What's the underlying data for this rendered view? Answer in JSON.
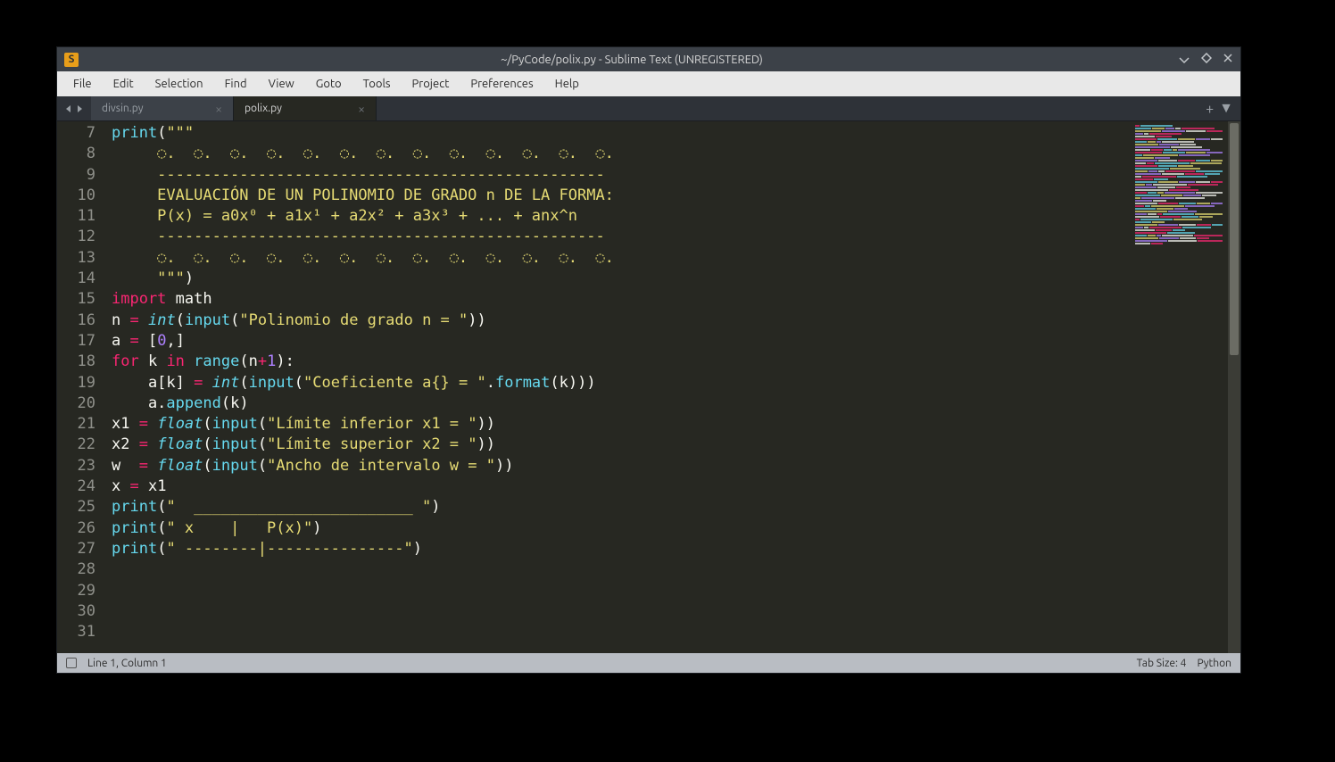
{
  "window": {
    "title": "~/PyCode/polix.py - Sublime Text (UNREGISTERED)",
    "app_icon_letter": "S"
  },
  "menubar": {
    "items": [
      "File",
      "Edit",
      "Selection",
      "Find",
      "View",
      "Goto",
      "Tools",
      "Project",
      "Preferences",
      "Help"
    ]
  },
  "tabs": {
    "items": [
      {
        "label": "divsin.py",
        "active": false
      },
      {
        "label": "polix.py",
        "active": true
      }
    ]
  },
  "editor": {
    "first_line_number": 7,
    "lines": [
      {
        "n": 7,
        "segments": [
          {
            "t": "print",
            "c": "k-call"
          },
          {
            "t": "(",
            "c": "k-punc"
          },
          {
            "t": "\"\"\"",
            "c": "k-str"
          }
        ]
      },
      {
        "n": 8,
        "segments": [
          {
            "t": "     ◌.  ◌.  ◌.  ◌.  ◌.  ◌.  ◌.  ◌.  ◌.  ◌.  ◌.  ◌.  ◌.",
            "c": "k-str"
          }
        ]
      },
      {
        "n": 9,
        "segments": [
          {
            "t": "     -------------------------------------------------",
            "c": "k-str"
          }
        ]
      },
      {
        "n": 10,
        "segments": [
          {
            "t": "     EVALUACIÓN DE UN POLINOMIO DE GRADO n DE LA FORMA:",
            "c": "k-str"
          }
        ]
      },
      {
        "n": 11,
        "segments": [
          {
            "t": "     P(x) = a0x⁰ + a1x¹ + a2x² + a3x³ + ... + anx^n",
            "c": "k-str"
          }
        ]
      },
      {
        "n": 12,
        "segments": [
          {
            "t": "     -------------------------------------------------",
            "c": "k-str"
          }
        ]
      },
      {
        "n": 13,
        "segments": [
          {
            "t": "     ◌.  ◌.  ◌.  ◌.  ◌.  ◌.  ◌.  ◌.  ◌.  ◌.  ◌.  ◌.  ◌.",
            "c": "k-str"
          }
        ]
      },
      {
        "n": 14,
        "segments": [
          {
            "t": "     \"\"\"",
            "c": "k-str"
          },
          {
            "t": ")",
            "c": "k-punc"
          }
        ]
      },
      {
        "n": 15,
        "segments": [
          {
            "t": "import",
            "c": "k-keyword"
          },
          {
            "t": " math",
            "c": "k-punc"
          }
        ]
      },
      {
        "n": 16,
        "segments": [
          {
            "t": "",
            "c": "k-punc"
          }
        ]
      },
      {
        "n": 17,
        "segments": [
          {
            "t": "n ",
            "c": "k-punc"
          },
          {
            "t": "=",
            "c": "k-keyword"
          },
          {
            "t": " ",
            "c": "k-punc"
          },
          {
            "t": "int",
            "c": "k-func"
          },
          {
            "t": "(",
            "c": "k-punc"
          },
          {
            "t": "input",
            "c": "k-call"
          },
          {
            "t": "(",
            "c": "k-punc"
          },
          {
            "t": "\"Polinomio de grado n = \"",
            "c": "k-str"
          },
          {
            "t": "))",
            "c": "k-punc"
          }
        ]
      },
      {
        "n": 18,
        "segments": [
          {
            "t": "",
            "c": "k-punc"
          }
        ]
      },
      {
        "n": 19,
        "segments": [
          {
            "t": "a ",
            "c": "k-punc"
          },
          {
            "t": "=",
            "c": "k-keyword"
          },
          {
            "t": " [",
            "c": "k-punc"
          },
          {
            "t": "0",
            "c": "k-num"
          },
          {
            "t": ",]",
            "c": "k-punc"
          }
        ]
      },
      {
        "n": 20,
        "segments": [
          {
            "t": "for",
            "c": "k-keyword"
          },
          {
            "t": " k ",
            "c": "k-punc"
          },
          {
            "t": "in",
            "c": "k-keyword"
          },
          {
            "t": " ",
            "c": "k-punc"
          },
          {
            "t": "range",
            "c": "k-call"
          },
          {
            "t": "(n",
            "c": "k-punc"
          },
          {
            "t": "+",
            "c": "k-keyword"
          },
          {
            "t": "1",
            "c": "k-num"
          },
          {
            "t": "):",
            "c": "k-punc"
          }
        ]
      },
      {
        "n": 21,
        "segments": [
          {
            "t": "    a[k] ",
            "c": "k-punc"
          },
          {
            "t": "=",
            "c": "k-keyword"
          },
          {
            "t": " ",
            "c": "k-punc"
          },
          {
            "t": "int",
            "c": "k-func"
          },
          {
            "t": "(",
            "c": "k-punc"
          },
          {
            "t": "input",
            "c": "k-call"
          },
          {
            "t": "(",
            "c": "k-punc"
          },
          {
            "t": "\"Coeficiente a{} = \"",
            "c": "k-str"
          },
          {
            "t": ".",
            "c": "k-punc"
          },
          {
            "t": "format",
            "c": "k-call"
          },
          {
            "t": "(k)))",
            "c": "k-punc"
          }
        ]
      },
      {
        "n": 22,
        "segments": [
          {
            "t": "    a.",
            "c": "k-punc"
          },
          {
            "t": "append",
            "c": "k-call"
          },
          {
            "t": "(k)",
            "c": "k-punc"
          }
        ]
      },
      {
        "n": 23,
        "segments": [
          {
            "t": "",
            "c": "k-punc"
          }
        ]
      },
      {
        "n": 24,
        "segments": [
          {
            "t": "x1 ",
            "c": "k-punc"
          },
          {
            "t": "=",
            "c": "k-keyword"
          },
          {
            "t": " ",
            "c": "k-punc"
          },
          {
            "t": "float",
            "c": "k-func"
          },
          {
            "t": "(",
            "c": "k-punc"
          },
          {
            "t": "input",
            "c": "k-call"
          },
          {
            "t": "(",
            "c": "k-punc"
          },
          {
            "t": "\"Límite inferior x1 = \"",
            "c": "k-str"
          },
          {
            "t": "))",
            "c": "k-punc"
          }
        ]
      },
      {
        "n": 25,
        "segments": [
          {
            "t": "x2 ",
            "c": "k-punc"
          },
          {
            "t": "=",
            "c": "k-keyword"
          },
          {
            "t": " ",
            "c": "k-punc"
          },
          {
            "t": "float",
            "c": "k-func"
          },
          {
            "t": "(",
            "c": "k-punc"
          },
          {
            "t": "input",
            "c": "k-call"
          },
          {
            "t": "(",
            "c": "k-punc"
          },
          {
            "t": "\"Límite superior x2 = \"",
            "c": "k-str"
          },
          {
            "t": "))",
            "c": "k-punc"
          }
        ]
      },
      {
        "n": 26,
        "segments": [
          {
            "t": "w  ",
            "c": "k-punc"
          },
          {
            "t": "=",
            "c": "k-keyword"
          },
          {
            "t": " ",
            "c": "k-punc"
          },
          {
            "t": "float",
            "c": "k-func"
          },
          {
            "t": "(",
            "c": "k-punc"
          },
          {
            "t": "input",
            "c": "k-call"
          },
          {
            "t": "(",
            "c": "k-punc"
          },
          {
            "t": "\"Ancho de intervalo w = \"",
            "c": "k-str"
          },
          {
            "t": "))",
            "c": "k-punc"
          }
        ]
      },
      {
        "n": 27,
        "segments": [
          {
            "t": "",
            "c": "k-punc"
          }
        ]
      },
      {
        "n": 28,
        "segments": [
          {
            "t": "x ",
            "c": "k-punc"
          },
          {
            "t": "=",
            "c": "k-keyword"
          },
          {
            "t": " x1",
            "c": "k-punc"
          }
        ]
      },
      {
        "n": 29,
        "segments": [
          {
            "t": "print",
            "c": "k-call"
          },
          {
            "t": "(",
            "c": "k-punc"
          },
          {
            "t": "\"  ________________________ \"",
            "c": "k-str"
          },
          {
            "t": ")",
            "c": "k-punc"
          }
        ]
      },
      {
        "n": 30,
        "segments": [
          {
            "t": "print",
            "c": "k-call"
          },
          {
            "t": "(",
            "c": "k-punc"
          },
          {
            "t": "\" x    |   P(x)\"",
            "c": "k-str"
          },
          {
            "t": ")",
            "c": "k-punc"
          }
        ]
      },
      {
        "n": 31,
        "segments": [
          {
            "t": "print",
            "c": "k-call"
          },
          {
            "t": "(",
            "c": "k-punc"
          },
          {
            "t": "\" --------|---------------\"",
            "c": "k-str"
          },
          {
            "t": ")",
            "c": "k-punc"
          }
        ]
      }
    ]
  },
  "statusbar": {
    "position": "Line 1, Column 1",
    "tab_size": "Tab Size: 4",
    "syntax": "Python"
  }
}
